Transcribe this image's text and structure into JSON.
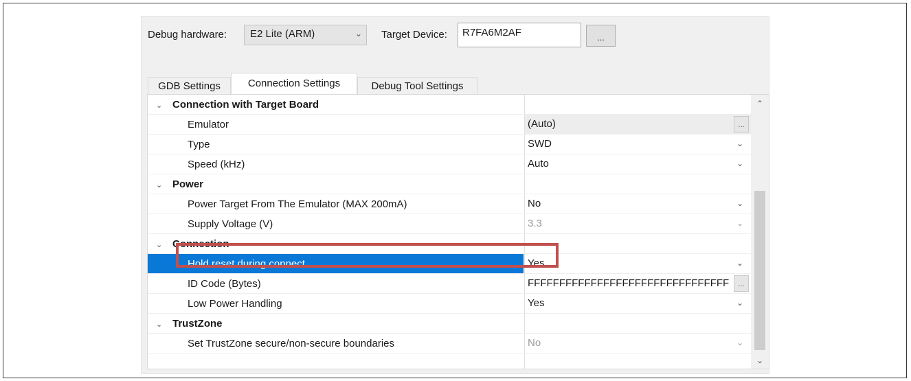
{
  "header": {
    "debug_hardware_label": "Debug hardware:",
    "debug_hardware_value": "E2 Lite (ARM)",
    "target_device_label": "Target Device:",
    "target_device_value": "R7FA6M2AF",
    "browse_button_label": "..."
  },
  "tabs": [
    {
      "label": "GDB Settings",
      "active": false
    },
    {
      "label": "Connection Settings",
      "active": true
    },
    {
      "label": "Debug Tool Settings",
      "active": false
    }
  ],
  "rows": [
    {
      "kind": "group",
      "name": "Connection with Target Board",
      "expander": "v"
    },
    {
      "kind": "item",
      "name": "Emulator",
      "value": "(Auto)",
      "control": "...",
      "shaded": true
    },
    {
      "kind": "item",
      "name": "Type",
      "value": "SWD",
      "control": "v"
    },
    {
      "kind": "item",
      "name": "Speed (kHz)",
      "value": "Auto",
      "control": "v"
    },
    {
      "kind": "group",
      "name": "Power",
      "expander": "v"
    },
    {
      "kind": "item",
      "name": "Power Target From The Emulator (MAX 200mA)",
      "value": "No",
      "control": "v"
    },
    {
      "kind": "item",
      "name": "Supply Voltage (V)",
      "value": "3.3",
      "control": "v",
      "disabled": true
    },
    {
      "kind": "group",
      "name": "Connection",
      "expander": "v"
    },
    {
      "kind": "item",
      "name": "Hold reset during connect",
      "value": "Yes",
      "control": "v",
      "selected": true
    },
    {
      "kind": "item",
      "name": "ID Code (Bytes)",
      "value": "FFFFFFFFFFFFFFFFFFFFFFFFFFFFFFFF",
      "control": "..."
    },
    {
      "kind": "item",
      "name": "Low Power Handling",
      "value": "Yes",
      "control": "v"
    },
    {
      "kind": "group",
      "name": "TrustZone",
      "expander": "v"
    },
    {
      "kind": "item",
      "name": "Set TrustZone secure/non-secure boundaries",
      "value": "No",
      "control": "v",
      "disabled": true
    }
  ],
  "colors": {
    "selection": "#0a78d7",
    "highlight_box": "#c0504d"
  }
}
